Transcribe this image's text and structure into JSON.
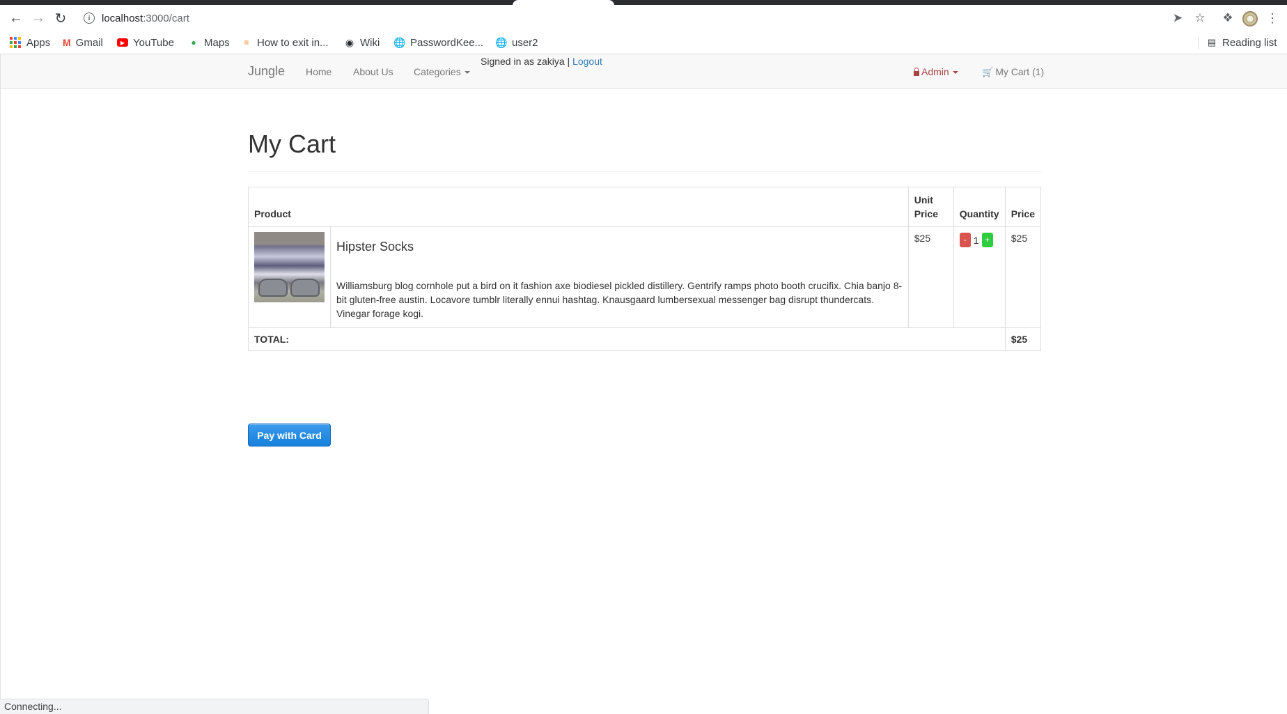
{
  "browser": {
    "url_host": "localhost",
    "url_path": ":3000/cart",
    "bookmarks": [
      {
        "label": "Apps"
      },
      {
        "label": "Gmail"
      },
      {
        "label": "YouTube"
      },
      {
        "label": "Maps"
      },
      {
        "label": "How to exit in..."
      },
      {
        "label": "Wiki"
      },
      {
        "label": "PasswordKee..."
      },
      {
        "label": "user2"
      }
    ],
    "reading_list": "Reading list",
    "status": "Connecting..."
  },
  "navbar": {
    "brand": "Jungle",
    "home": "Home",
    "about": "About Us",
    "categories": "Categories",
    "signed_in_text": "Signed in as zakiya |",
    "logout": "Logout",
    "admin": "Admin",
    "cart": "My Cart (1)"
  },
  "page": {
    "title": "My Cart"
  },
  "table": {
    "headers": {
      "product": "Product",
      "unit_price_line1": "Unit",
      "unit_price_line2": "Price",
      "quantity": "Quantity",
      "price": "Price"
    },
    "items": [
      {
        "name": "Hipster Socks",
        "description": "Williamsburg blog cornhole put a bird on it fashion axe biodiesel pickled distillery. Gentrify ramps photo booth crucifix. Chia banjo 8-bit gluten-free austin. Locavore tumblr literally ennui hashtag. Knausgaard lumbersexual messenger bag disrupt thundercats. Vinegar forage kogi.",
        "unit_price": "$25",
        "quantity": "1",
        "minus_label": "-",
        "plus_label": "+",
        "price": "$25"
      }
    ],
    "total_label": "TOTAL:",
    "total_value": "$25"
  },
  "actions": {
    "pay_label": "Pay with Card"
  },
  "colors": {
    "primary_button": "#1680dc",
    "minus_button": "#d9534f",
    "plus_button": "#2ecc40",
    "admin_text": "#a94442",
    "link": "#337ab7"
  }
}
